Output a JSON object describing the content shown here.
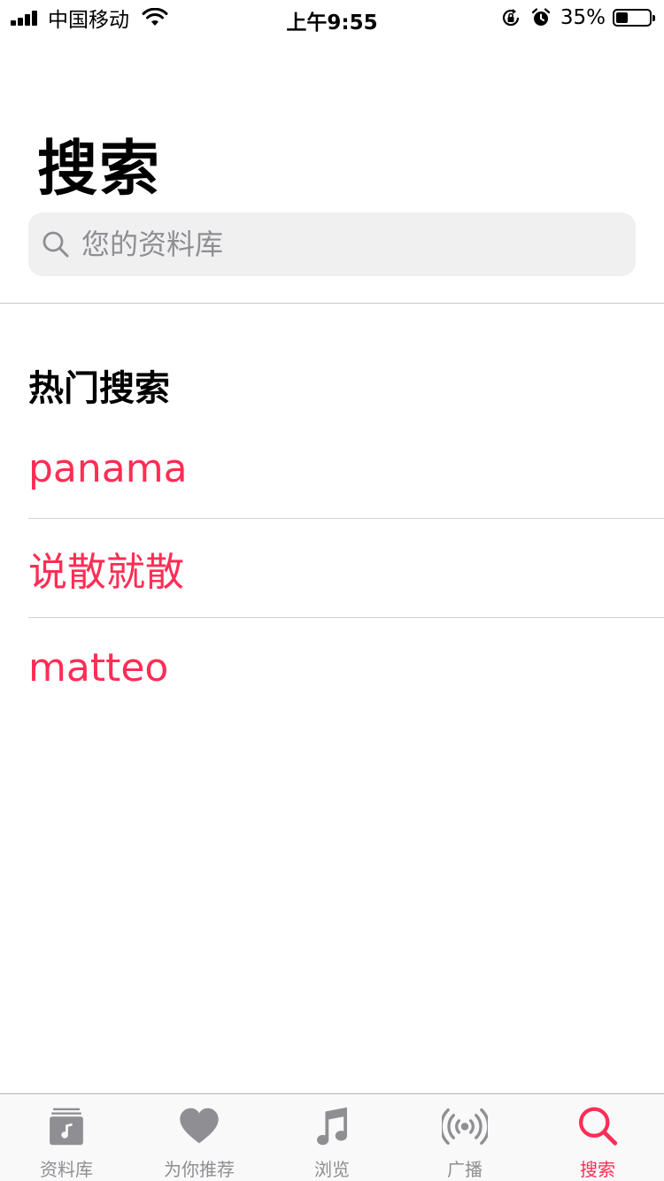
{
  "status_bar": {
    "carrier": "中国移动",
    "time": "上午9:55",
    "battery_percent_text": "35%",
    "battery_level": 0.35
  },
  "page": {
    "title": "搜索"
  },
  "search": {
    "placeholder": "您的资料库",
    "value": ""
  },
  "trending": {
    "heading": "热门搜索",
    "items": [
      "panama",
      "说散就散",
      "matteo"
    ]
  },
  "tab_bar": {
    "tabs": [
      {
        "label": "资料库",
        "icon": "library-icon",
        "active": false
      },
      {
        "label": "为你推荐",
        "icon": "heart-icon",
        "active": false
      },
      {
        "label": "浏览",
        "icon": "music-note-icon",
        "active": false
      },
      {
        "label": "广播",
        "icon": "radio-icon",
        "active": false
      },
      {
        "label": "搜索",
        "icon": "search-icon",
        "active": true
      }
    ]
  },
  "colors": {
    "accent": "#ff2d55",
    "inactive": "#8e8e93",
    "search_field_bg": "#f0f0f1"
  }
}
